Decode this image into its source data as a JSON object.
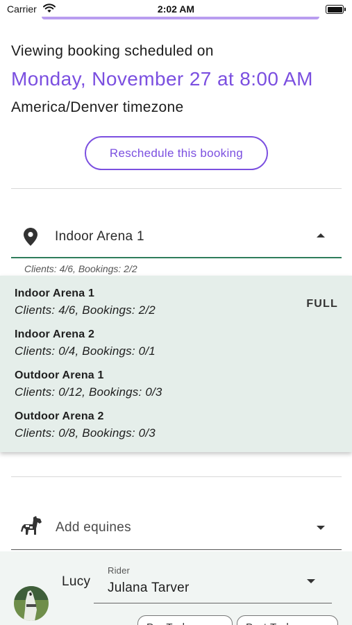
{
  "status_bar": {
    "carrier": "Carrier",
    "time": "2:02 AM"
  },
  "booking": {
    "intro": "Viewing booking scheduled on",
    "date": "Monday, November 27 at 8:00 AM",
    "timezone": "America/Denver timezone",
    "reschedule_label": "Reschedule this booking"
  },
  "location": {
    "selected": "Indoor Arena 1",
    "helper": "Clients: 4/6, Bookings: 2/2",
    "options": [
      {
        "name": "Indoor Arena 1",
        "stats": "Clients: 4/6, Bookings: 2/2",
        "badge": "FULL"
      },
      {
        "name": "Indoor Arena 2",
        "stats": "Clients: 0/4, Bookings: 0/1"
      },
      {
        "name": "Outdoor Arena 1",
        "stats": "Clients: 0/12, Bookings: 0/3"
      },
      {
        "name": "Outdoor Arena 2",
        "stats": "Clients: 0/8, Bookings: 0/3"
      }
    ]
  },
  "equines": {
    "placeholder": "Add equines",
    "entries": [
      {
        "name": "Lucy",
        "rider_label": "Rider",
        "rider": "Julana Tarver",
        "buttons": [
          "Pre-Tack",
          "Post-Tack"
        ]
      }
    ]
  },
  "colors": {
    "accent": "#7b4fe0",
    "field_focus": "#2e7d5b",
    "menu_background": "#e5eeea"
  },
  "icons": {
    "location": "map-pin-icon",
    "equines": "horse-icon",
    "expand": "caret-up-icon",
    "collapse": "caret-down-icon"
  }
}
